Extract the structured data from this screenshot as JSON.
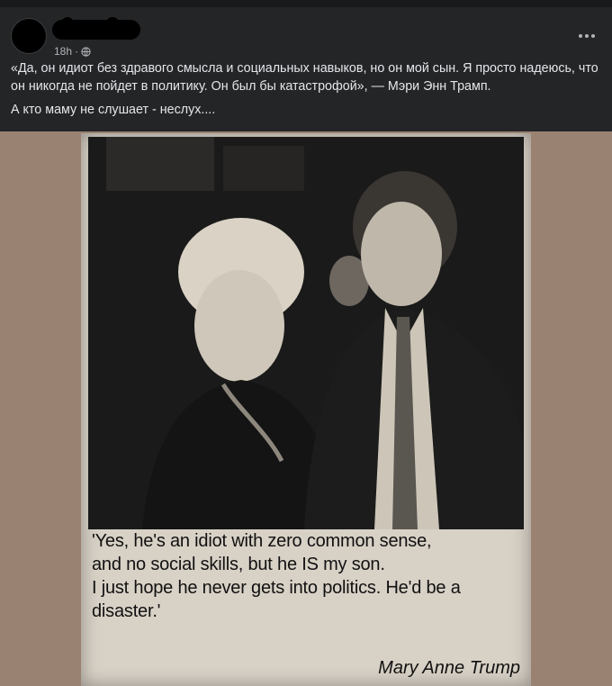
{
  "post": {
    "time": "18h",
    "privacy_icon": "globe-icon",
    "more_icon": "more-horizontal-icon",
    "text_line1": "«Да, он идиот без здравого смысла и социальных навыков, но он мой сын. Я просто надеюсь, что он никогда не пойдет в политику. Он был бы катастрофой», — Мэри Энн Трамп.",
    "text_line2": "А кто маму не слушает - неслух...."
  },
  "clipping": {
    "quote_lines": [
      "'Yes, he's an idiot with zero common sense,",
      "and no social skills, but he IS my son.",
      "I just hope he never gets into politics. He'd be a",
      "disaster.'"
    ],
    "credit": "Mary Anne Trump"
  },
  "colors": {
    "background": "#242526",
    "text": "#e4e6eb",
    "secondary_text": "#b0b3b8",
    "photo_backdrop": "#9a8272",
    "newspaper": "#d8d1c6"
  }
}
